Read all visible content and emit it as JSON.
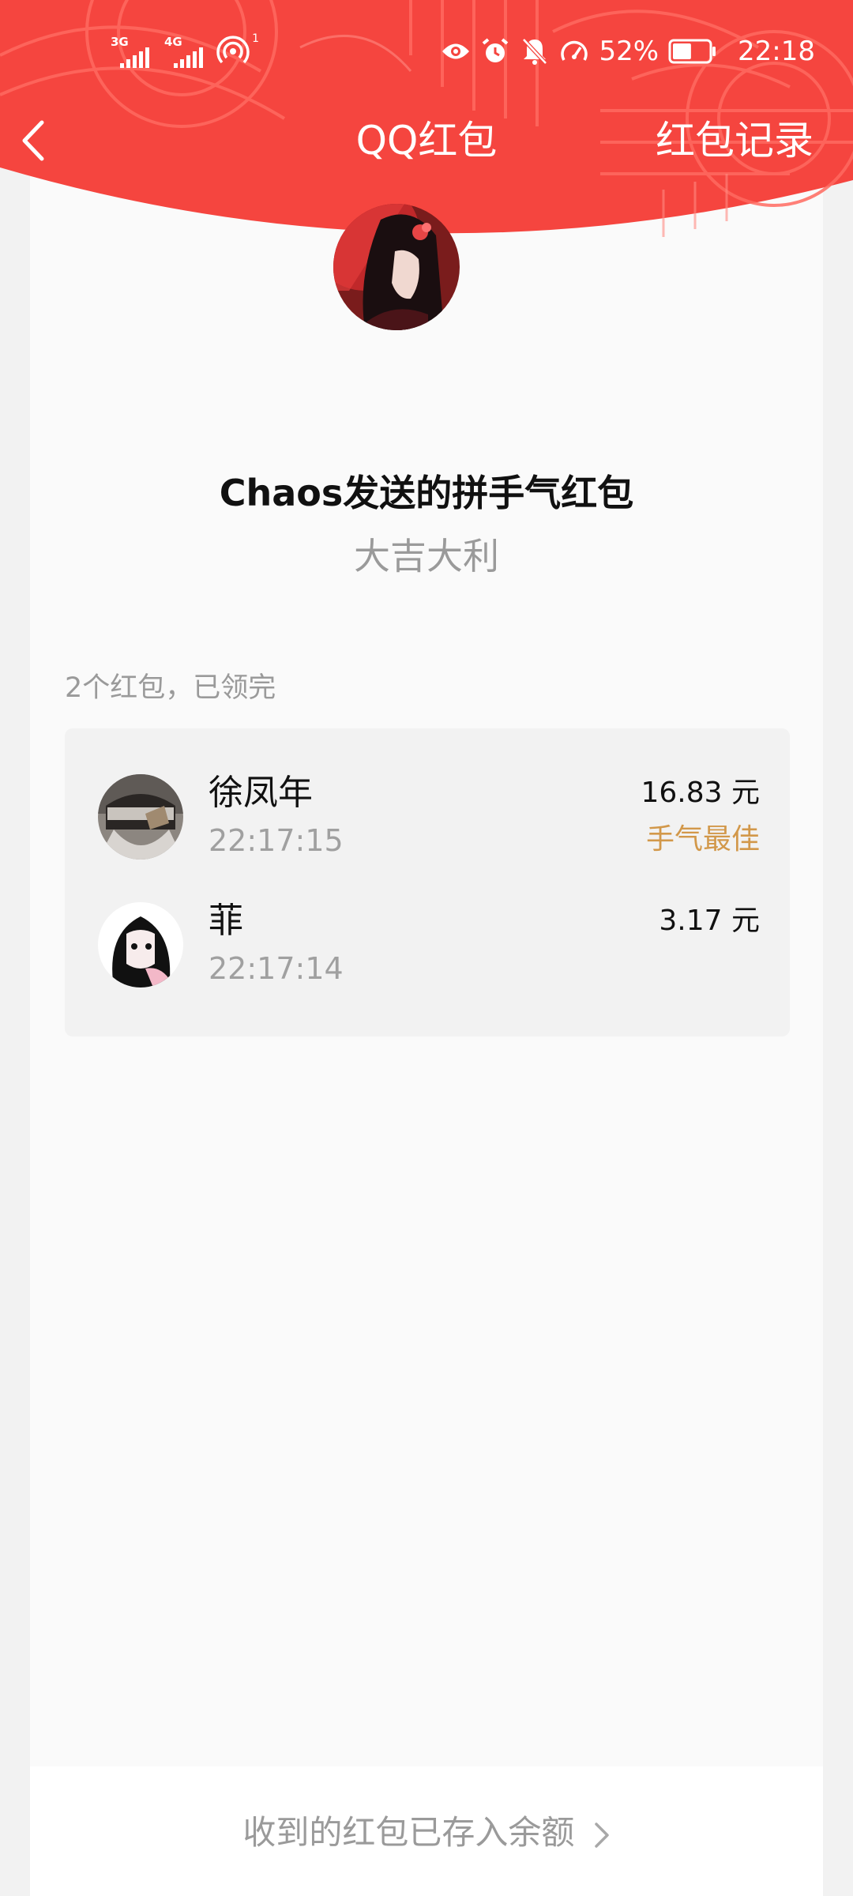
{
  "status_bar": {
    "sim1_type": "3G",
    "sim2_type": "4G",
    "hotspot_count": "1",
    "battery_percent": "52%",
    "time": "22:18"
  },
  "nav": {
    "title": "QQ红包",
    "record_link": "红包记录"
  },
  "packet": {
    "sender_title": "Chaos发送的拼手气红包",
    "greeting": "大吉大利",
    "summary": "2个红包，已领完"
  },
  "records": [
    {
      "name": "徐凤年",
      "time": "22:17:15",
      "amount": "16.83 元",
      "badge": "手气最佳"
    },
    {
      "name": "菲",
      "time": "22:17:14",
      "amount": "3.17 元",
      "badge": ""
    }
  ],
  "footer": {
    "link_text": "收到的红包已存入余额"
  },
  "colors": {
    "header_red": "#f5453f",
    "best_luck_gold": "#d2984a"
  },
  "icons": [
    "eye-icon",
    "alarm-icon",
    "mute-bell-icon",
    "speed-icon",
    "battery-icon",
    "back-icon",
    "chevron-right-icon",
    "signal-icon",
    "hotspot-icon"
  ]
}
